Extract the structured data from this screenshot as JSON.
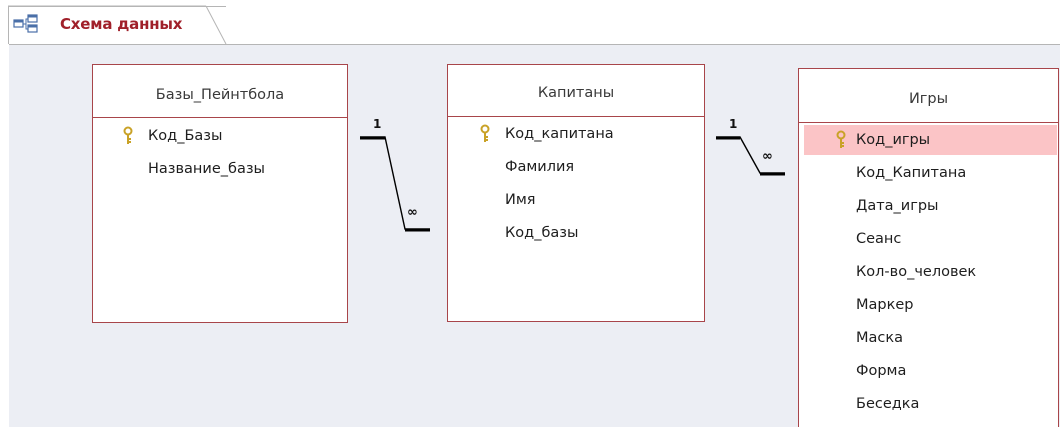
{
  "tab": {
    "label": "Схема данных",
    "icon": "relationships-icon",
    "label_color": "#a0202a"
  },
  "tables": [
    {
      "title": "Базы_Пейнтбола",
      "fields": [
        {
          "name": "Код_Базы",
          "key": true
        },
        {
          "name": "Название_базы",
          "key": false
        }
      ]
    },
    {
      "title": "Капитаны",
      "fields": [
        {
          "name": "Код_капитана",
          "key": true
        },
        {
          "name": "Фамилия",
          "key": false
        },
        {
          "name": "Имя",
          "key": false
        },
        {
          "name": "Код_базы",
          "key": false
        }
      ]
    },
    {
      "title": "Игры",
      "selected_field": "Код_игры",
      "fields": [
        {
          "name": "Код_игры",
          "key": true
        },
        {
          "name": "Код_Капитана",
          "key": false
        },
        {
          "name": "Дата_игры",
          "key": false
        },
        {
          "name": "Сеанс",
          "key": false
        },
        {
          "name": "Кол-во_человек",
          "key": false
        },
        {
          "name": "Маркер",
          "key": false
        },
        {
          "name": "Маска",
          "key": false
        },
        {
          "name": "Форма",
          "key": false
        },
        {
          "name": "Беседка",
          "key": false
        }
      ]
    }
  ],
  "relationships": [
    {
      "from": "Базы_Пейнтбола.Код_Базы",
      "to": "Капитаны.Код_базы",
      "one_label": "1",
      "many_label": "∞"
    },
    {
      "from": "Капитаны.Код_капитана",
      "to": "Игры.Код_Капитана",
      "one_label": "1",
      "many_label": "∞"
    }
  ],
  "colors": {
    "table_border": "#a8454a",
    "canvas": "#eceef4",
    "selection": "#fbc4c6",
    "key_icon": "#c9a227"
  }
}
